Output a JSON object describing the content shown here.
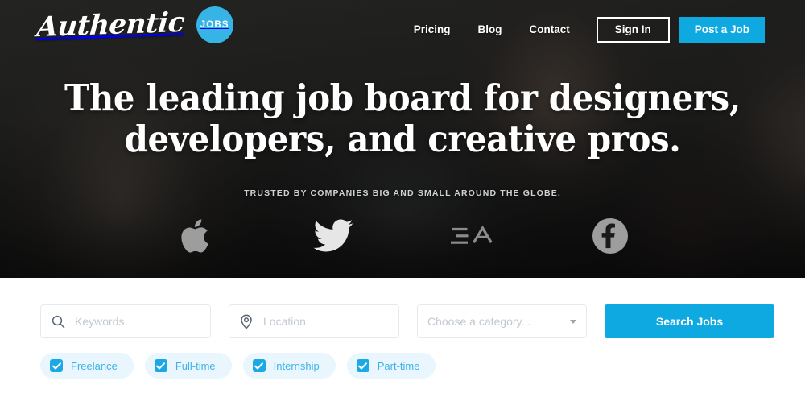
{
  "brand": {
    "wordmark": "Authentic",
    "badge": "JOBS"
  },
  "nav": {
    "links": [
      {
        "label": "Pricing",
        "name": "nav-link-pricing"
      },
      {
        "label": "Blog",
        "name": "nav-link-blog"
      },
      {
        "label": "Contact",
        "name": "nav-link-contact"
      }
    ],
    "sign_in": "Sign In",
    "post_a_job": "Post a Job"
  },
  "hero": {
    "headline_line1": "The leading job board for designers,",
    "headline_line2": "developers, and creative pros.",
    "trusted_text": "TRUSTED BY COMPANIES BIG AND SMALL AROUND THE GLOBE.",
    "logos": [
      {
        "name": "apple-logo-icon",
        "label": "Apple"
      },
      {
        "name": "twitter-logo-icon",
        "label": "Twitter"
      },
      {
        "name": "ea-logo-icon",
        "label": "EA"
      },
      {
        "name": "facebook-logo-icon",
        "label": "Facebook"
      }
    ]
  },
  "search": {
    "keywords": {
      "value": "",
      "placeholder": "Keywords",
      "icon": "search-icon"
    },
    "location": {
      "value": "",
      "placeholder": "Location",
      "icon": "map-pin-icon"
    },
    "category": {
      "selected": "Choose a category...",
      "icon": "chevron-down-icon"
    },
    "submit_label": "Search Jobs"
  },
  "filters": [
    {
      "label": "Freelance",
      "checked": true
    },
    {
      "label": "Full-time",
      "checked": true
    },
    {
      "label": "Internship",
      "checked": true
    },
    {
      "label": "Part-time",
      "checked": true
    }
  ],
  "colors": {
    "accent_blue": "#0fa9e2",
    "badge_blue": "#36b4e5",
    "chip_bg": "#e9f6fd",
    "chip_text": "#3eb3e8",
    "field_border": "#e6e9ed",
    "placeholder": "#c3c9d0",
    "hero_dark": "#1a1a1a"
  }
}
